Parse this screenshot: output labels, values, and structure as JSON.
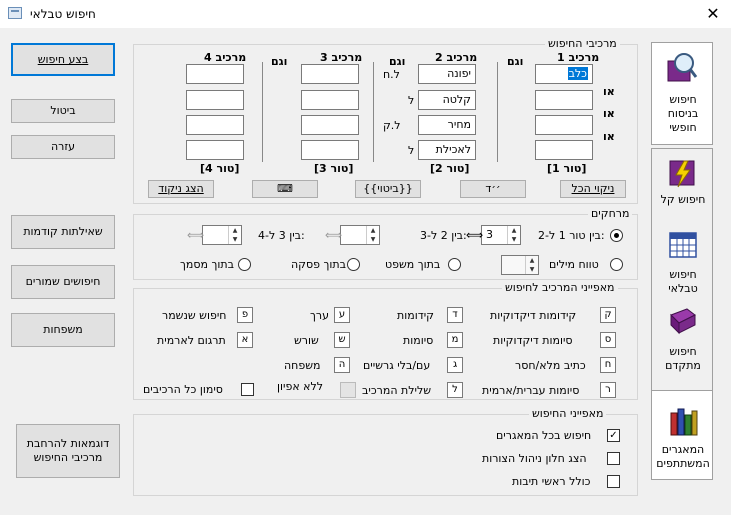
{
  "window": {
    "title": "חיפוש טבלאי",
    "close_glyph": "✕"
  },
  "buttons": {
    "search": "בצע חיפוש",
    "cancel": "ביטול",
    "help": "עזרה",
    "prev_queries": "שאילתות קודמות",
    "saved_searches": "חיפושים שמורים",
    "families": "משפחות",
    "examples": "דוגמאות להרחבת מרכיבי החיפוש"
  },
  "components": {
    "legend": "מרכיבי החיפוש",
    "col1_header": "מרכיב 1",
    "col2_header": "מרכיב 2",
    "col3_header": "מרכיב 3",
    "col4_header": "מרכיב 4",
    "and_label": "וגם",
    "or_label": "או",
    "col1_values": [
      "כלב",
      "",
      "",
      ""
    ],
    "col2_values": [
      "יפונה",
      "קלטה",
      "מחיר",
      "לאכילת"
    ],
    "col2_markers": [
      "ל.ח",
      "ל",
      "ל.ק",
      "ל"
    ],
    "col3_values": [
      "",
      "",
      "",
      ""
    ],
    "col4_values": [
      "",
      "",
      "",
      ""
    ],
    "col1_footer": "[טור 1]",
    "col2_footer": "[טור 2]",
    "col3_footer": "[טור 3]",
    "col4_footer": "[טור 4]",
    "clear_all": "ניקוי הכל",
    "special_chars": "׳׳ד",
    "expression": "{{ביטוי}}",
    "keyboard": "⌨",
    "show_clear": "הצג ניקוד"
  },
  "distances": {
    "legend": "מרחקים",
    "between_1_2": "בין טור 1 ל-2:",
    "between_2_3": "בין 2 ל-3:",
    "between_3_4": "בין 3 ל-4:",
    "val_1_2": "3",
    "val_2_3": "",
    "val_3_4": "",
    "word_range": "טווח מילים",
    "in_sentence": "בתוך משפט",
    "in_paragraph": "בתוך פסקה",
    "in_document": "בתוך מסמך",
    "word_range_value": ""
  },
  "features": {
    "legend": "מאפייני המרכיב לחיפוש",
    "items": [
      {
        "key": "ק",
        "label": "קידומות דיקדוקיות"
      },
      {
        "key": "ד",
        "label": "קידומות"
      },
      {
        "key": "ע",
        "label": "ערך"
      },
      {
        "key": "פ",
        "label": "חיפוש שנשמר"
      },
      {
        "key": "ס",
        "label": "סיומות דיקדוקיות"
      },
      {
        "key": "מ",
        "label": "סיומות"
      },
      {
        "key": "ש",
        "label": "שורש"
      },
      {
        "key": "א",
        "label": "תרגום לארמית"
      },
      {
        "key": "ח",
        "label": "כתיב מלא/חסר"
      },
      {
        "key": "ג",
        "label": "עם/בלי גרשיים"
      },
      {
        "key": "ה",
        "label": "משפחה"
      },
      {
        "key": "ר",
        "label": "סיומות עברית/ארמית"
      },
      {
        "key": "ל",
        "label": "שלילת המרכיב"
      },
      {
        "key": "",
        "label": "ללא אפיון"
      }
    ],
    "mark_all": "סימון כל הרכיבים"
  },
  "search_features": {
    "legend": "מאפייני החיפוש",
    "all_repositories": "חיפוש בכל המאגרים",
    "show_window": "הצג חלון ניהול הצורות",
    "include_abbrev": "כולל ראשי תיבות"
  },
  "sidebar": {
    "basic": "חיפוש בניסוח חופשי",
    "easy": "חיפוש קל",
    "table": "חיפוש טבלאי",
    "advanced": "חיפוש מתקדם",
    "repositories": "המאגרים המשתתפים"
  },
  "colors": {
    "accent": "#0078d7",
    "selection": "#0078d7"
  }
}
